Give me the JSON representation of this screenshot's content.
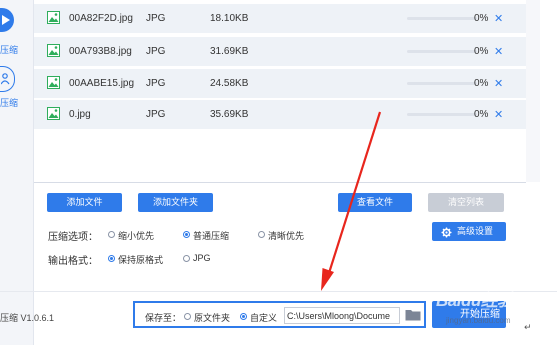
{
  "sidebar": {
    "items": [
      {
        "label": "压缩",
        "icon": "play-icon"
      },
      {
        "label": "压缩",
        "icon": "person-icon"
      }
    ]
  },
  "files": [
    {
      "name": "00A82F2D.jpg",
      "type": "JPG",
      "size": "18.10KB",
      "progress": "0%",
      "progress_value": 0
    },
    {
      "name": "00A793B8.jpg",
      "type": "JPG",
      "size": "31.69KB",
      "progress": "0%",
      "progress_value": 0
    },
    {
      "name": "00AABE15.jpg",
      "type": "JPG",
      "size": "24.58KB",
      "progress": "0%",
      "progress_value": 0
    },
    {
      "name": "0.jpg",
      "type": "JPG",
      "size": "35.69KB",
      "progress": "0%",
      "progress_value": 0
    }
  ],
  "remove_glyph": "✕",
  "buttons": {
    "add_file": "添加文件",
    "add_folder": "添加文件夹",
    "view_files": "查看文件",
    "clear_list": "清空列表",
    "advanced": "高级设置",
    "start": "开始压缩"
  },
  "compress": {
    "label": "压缩选项：",
    "options": [
      "缩小优先",
      "普通压缩",
      "清晰优先"
    ],
    "selected": "普通压缩"
  },
  "output": {
    "label": "输出格式：",
    "options": [
      "保持原格式",
      "JPG"
    ],
    "selected": "保持原格式"
  },
  "save": {
    "label": "保存至：",
    "options": [
      "原文件夹",
      "自定义"
    ],
    "selected": "自定义",
    "path": "C:\\Users\\Mloong\\Docume"
  },
  "version": "压缩 V1.0.6.1",
  "watermark": {
    "text": "Baidu经验",
    "sub": "jingyan.baidu.com"
  },
  "corner_mark": "↵",
  "colors": {
    "accent": "#2f7bea",
    "arrow": "#e8261d",
    "gray_button": "#c8cdd6",
    "row_bg": "#eef2f7"
  }
}
